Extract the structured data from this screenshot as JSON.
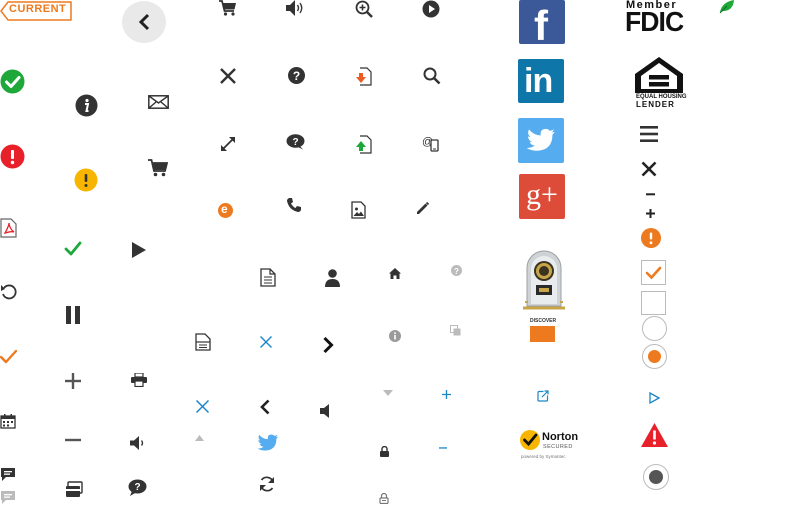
{
  "colors": {
    "orange": "#ee7a1f",
    "green": "#1fa83a",
    "red": "#e8202a",
    "yellow": "#f7b500",
    "dark": "#333333",
    "gray": "#9a9a9a",
    "blue": "#1a86c7",
    "facebook": "#3b5998",
    "linkedin": "#0e76a8",
    "twitter": "#55acee",
    "googleplus": "#dd4b39"
  },
  "badges": {
    "current_label": "CURRENT"
  },
  "logos": {
    "fdic_top": "Member",
    "fdic_main": "FDIC",
    "ehl_line1": "EQUAL HOUSING",
    "ehl_line2": "LENDER",
    "discover": "DISCOVER",
    "norton_main": "Norton",
    "norton_sub": "SECURED",
    "norton_powered": "powered by Symantec"
  },
  "social": {
    "facebook": "f",
    "linkedin": "in",
    "googleplus": "g+"
  },
  "icons": {
    "e_letter": "e"
  }
}
